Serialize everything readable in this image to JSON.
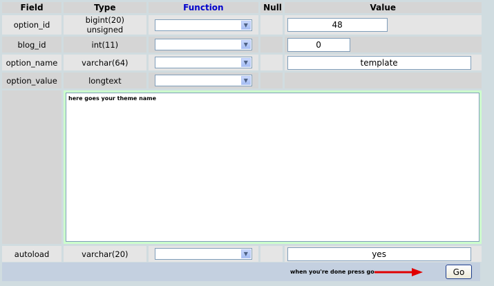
{
  "headers": {
    "field": "Field",
    "type": "Type",
    "function": "Function",
    "null": "Null",
    "value": "Value"
  },
  "rows": [
    {
      "field": "option_id",
      "type": "bigint(20) unsigned",
      "value": "48"
    },
    {
      "field": "blog_id",
      "type": "int(11)",
      "value": "0"
    },
    {
      "field": "option_name",
      "type": "varchar(64)",
      "value": "template"
    },
    {
      "field": "option_value",
      "type": "longtext",
      "value": "here goes your theme name"
    },
    {
      "field": "autoload",
      "type": "varchar(20)",
      "value": "yes"
    }
  ],
  "footer": {
    "hint": "when you're done press go",
    "go_label": "Go"
  },
  "colors": {
    "accent_arrow": "#e00000",
    "function_header": "#0000cc",
    "textarea_bg": "#ccffcc"
  }
}
